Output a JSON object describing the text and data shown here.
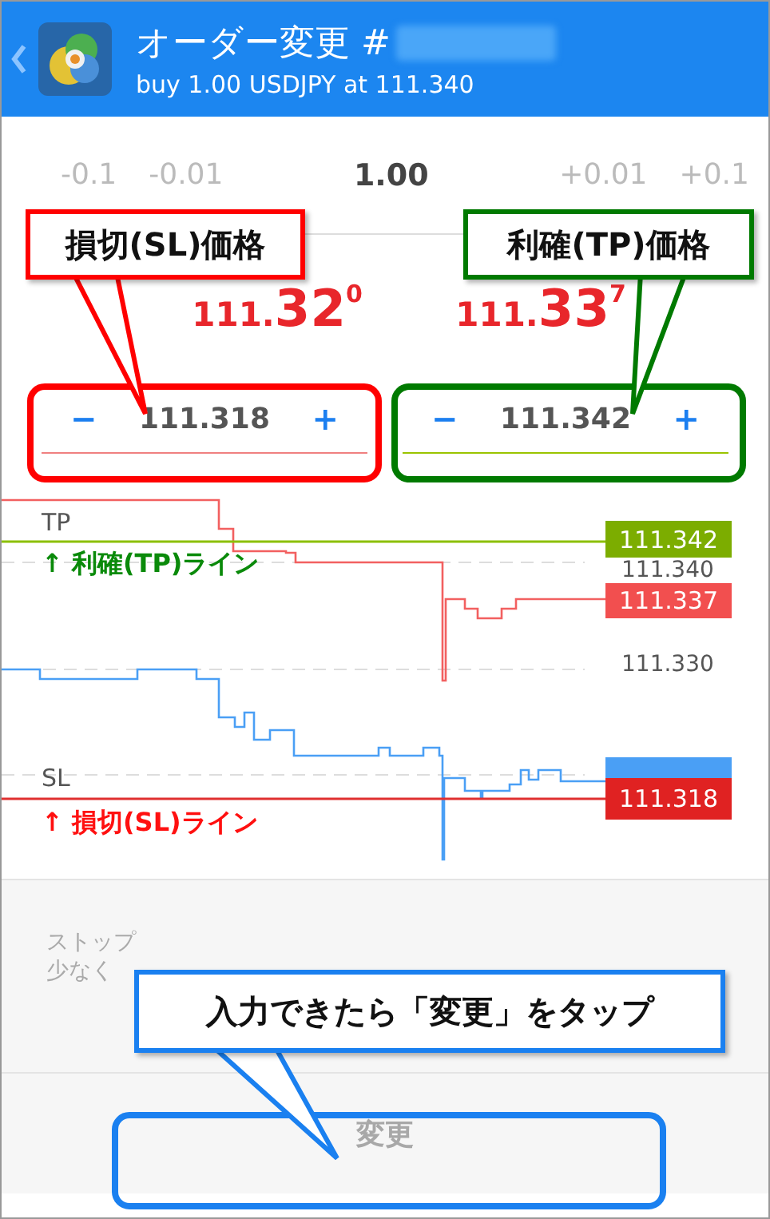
{
  "header": {
    "title": "オーダー変更 #",
    "subtitle": "buy 1.00 USDJPY at 111.340"
  },
  "volume": {
    "decrease": [
      "-0.1",
      "-0.01"
    ],
    "value": "1.00",
    "increase": [
      "+0.01",
      "+0.1"
    ]
  },
  "quotes": [
    {
      "prefix": "111.",
      "pips": "32",
      "point": "0"
    },
    {
      "prefix": "111.",
      "pips": "33",
      "point": "7"
    }
  ],
  "fields": [
    {
      "kind": "sl",
      "minus": "−",
      "value": "111.318",
      "plus": "+"
    },
    {
      "kind": "tp",
      "minus": "−",
      "value": "111.342",
      "plus": "+"
    }
  ],
  "chart": {
    "tp_label": "TP",
    "sl_label": "SL",
    "axis_labels": [
      "111.340",
      "111.330"
    ],
    "tags": [
      {
        "value": "111.342",
        "color": "#7cad00"
      },
      {
        "value": "111.337",
        "color": "#f24f4f"
      },
      {
        "value": "111.318",
        "color": "#e02222"
      }
    ]
  },
  "note": [
    "ストップ",
    "少なく"
  ],
  "button": {
    "label": "変更",
    "disabled": true
  },
  "callouts": [
    {
      "text": "損切(SL)価格",
      "color": "#ff0000"
    },
    {
      "text": "利確(TP)価格",
      "color": "#007a00"
    },
    {
      "text": "入力できたら「変更」をタップ",
      "color": "#1a80f0"
    }
  ],
  "line_notes": [
    {
      "text": "↑ 利確(TP)ライン",
      "color": "#0a8a0a"
    },
    {
      "text": "↑ 損切(SL)ライン",
      "color": "#ff1010"
    }
  ]
}
